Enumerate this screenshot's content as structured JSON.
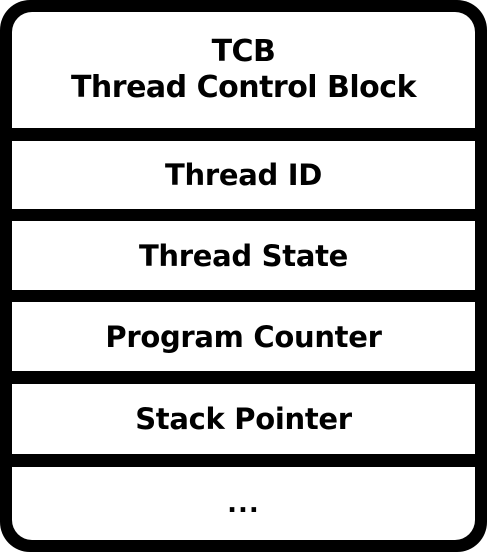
{
  "header": {
    "abbreviation": "TCB",
    "full_name": "Thread Control Block"
  },
  "fields": [
    {
      "label": "Thread ID"
    },
    {
      "label": "Thread State"
    },
    {
      "label": "Program Counter"
    },
    {
      "label": "Stack Pointer"
    },
    {
      "label": "..."
    }
  ],
  "colors": {
    "frame": "#000000",
    "cell_background": "#ffffff",
    "text": "#000000"
  }
}
